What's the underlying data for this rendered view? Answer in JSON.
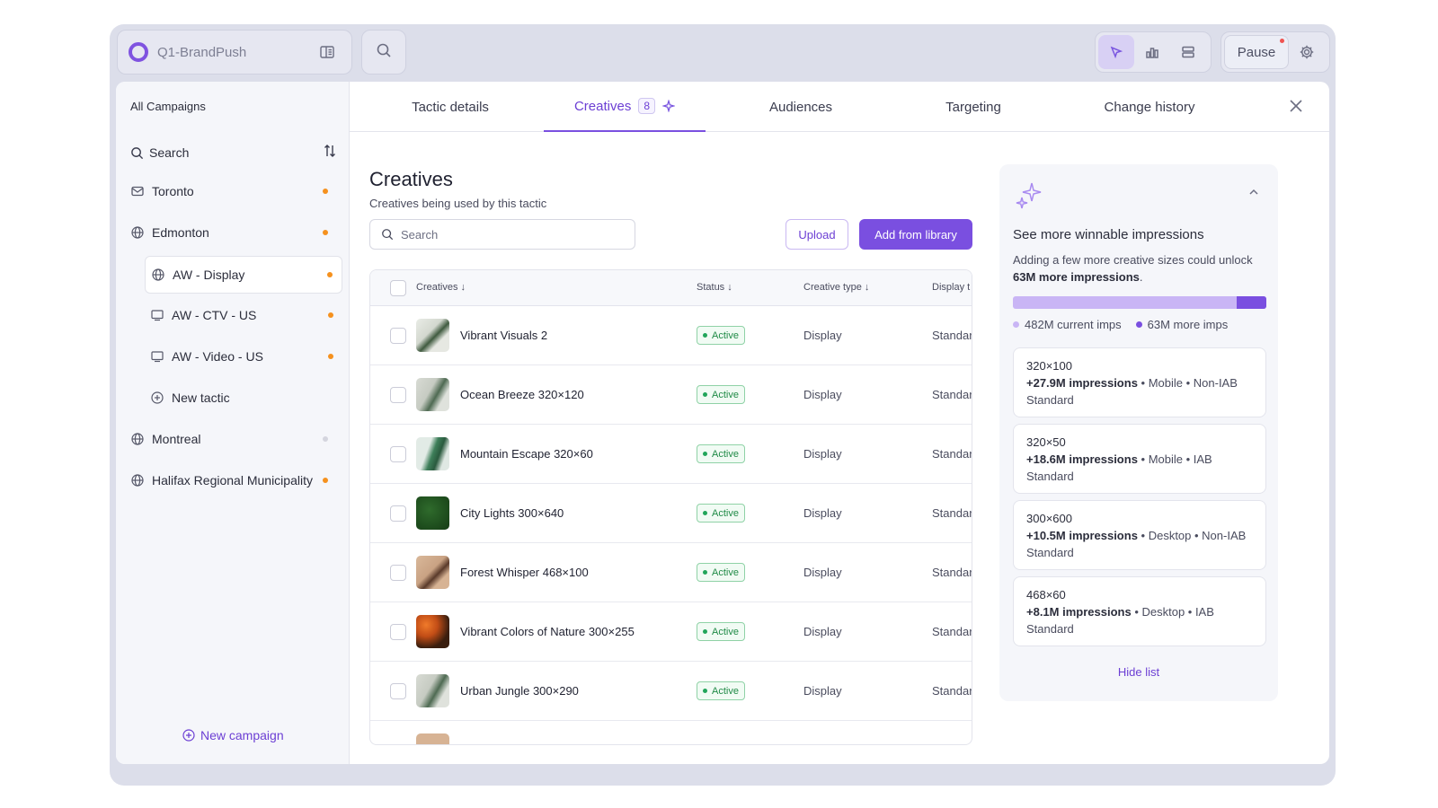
{
  "app": {
    "name": "Q1-BrandPush",
    "pause_label": "Pause"
  },
  "sidebar": {
    "title": "All Campaigns",
    "search_label": "Search",
    "items": [
      {
        "label": "Toronto",
        "icon": "mail-icon",
        "status": "orange"
      },
      {
        "label": "Edmonton",
        "icon": "globe-icon",
        "status": "orange"
      },
      {
        "label": "AW - Display",
        "icon": "globe-icon",
        "status": "orange",
        "selected": true
      },
      {
        "label": "AW - CTV - US",
        "icon": "tv-icon",
        "status": "orange"
      },
      {
        "label": "AW - Video - US",
        "icon": "tv-icon",
        "status": "orange"
      },
      {
        "label": "New tactic",
        "icon": "plus-circle-icon"
      },
      {
        "label": "Montreal",
        "icon": "globe-icon",
        "status": "grey"
      },
      {
        "label": "Halifax Regional Municipality",
        "icon": "globe-icon",
        "status": "orange"
      }
    ],
    "new_campaign": "New campaign"
  },
  "tabs": [
    {
      "label": "Tactic details"
    },
    {
      "label": "Creatives",
      "count": "8",
      "active": true
    },
    {
      "label": "Audiences"
    },
    {
      "label": "Targeting"
    },
    {
      "label": "Change history"
    }
  ],
  "creatives": {
    "title": "Creatives",
    "subtitle": "Creatives being used by this tactic",
    "search_placeholder": "Search",
    "upload_label": "Upload",
    "add_label": "Add from library",
    "columns": [
      "Creatives",
      "Status",
      "Creative type",
      "Display t"
    ],
    "rows": [
      {
        "name": "Vibrant Visuals 2",
        "status": "Active",
        "type": "Display",
        "display": "Standar"
      },
      {
        "name": "Ocean Breeze 320×120",
        "status": "Active",
        "type": "Display",
        "display": "Standar"
      },
      {
        "name": "Mountain Escape 320×60",
        "status": "Active",
        "type": "Display",
        "display": "Standar"
      },
      {
        "name": "City Lights 300×640",
        "status": "Active",
        "type": "Display",
        "display": "Standar"
      },
      {
        "name": "Forest Whisper 468×100",
        "status": "Active",
        "type": "Display",
        "display": "Standar"
      },
      {
        "name": "Vibrant Colors of Nature 300×255",
        "status": "Active",
        "type": "Display",
        "display": "Standar"
      },
      {
        "name": "Urban Jungle 300×290",
        "status": "Active",
        "type": "Display",
        "display": "Standar"
      }
    ]
  },
  "insights": {
    "title": "See more winnable impressions",
    "desc_prefix": "Adding a few more creative sizes could unlock ",
    "desc_bold": "63M more impressions",
    "desc_suffix": ".",
    "current_label": "482M current imps",
    "more_label": "63M more imps",
    "more_fraction": 0.116,
    "colors": {
      "current": "#c9b5f5",
      "more": "#7a4fe0"
    },
    "cards": [
      {
        "size": "320×100",
        "impr": "+27.9M impressions",
        "rest": " • Mobile • Non-IAB Standard"
      },
      {
        "size": "320×50",
        "impr": "+18.6M impressions",
        "rest": " • Mobile • IAB Standard"
      },
      {
        "size": "300×600",
        "impr": "+10.5M impressions",
        "rest": " • Desktop • Non-IAB Standard"
      },
      {
        "size": "468×60",
        "impr": "+8.1M impressions",
        "rest": " • Desktop • IAB Standard"
      }
    ],
    "hide_label": "Hide list"
  }
}
